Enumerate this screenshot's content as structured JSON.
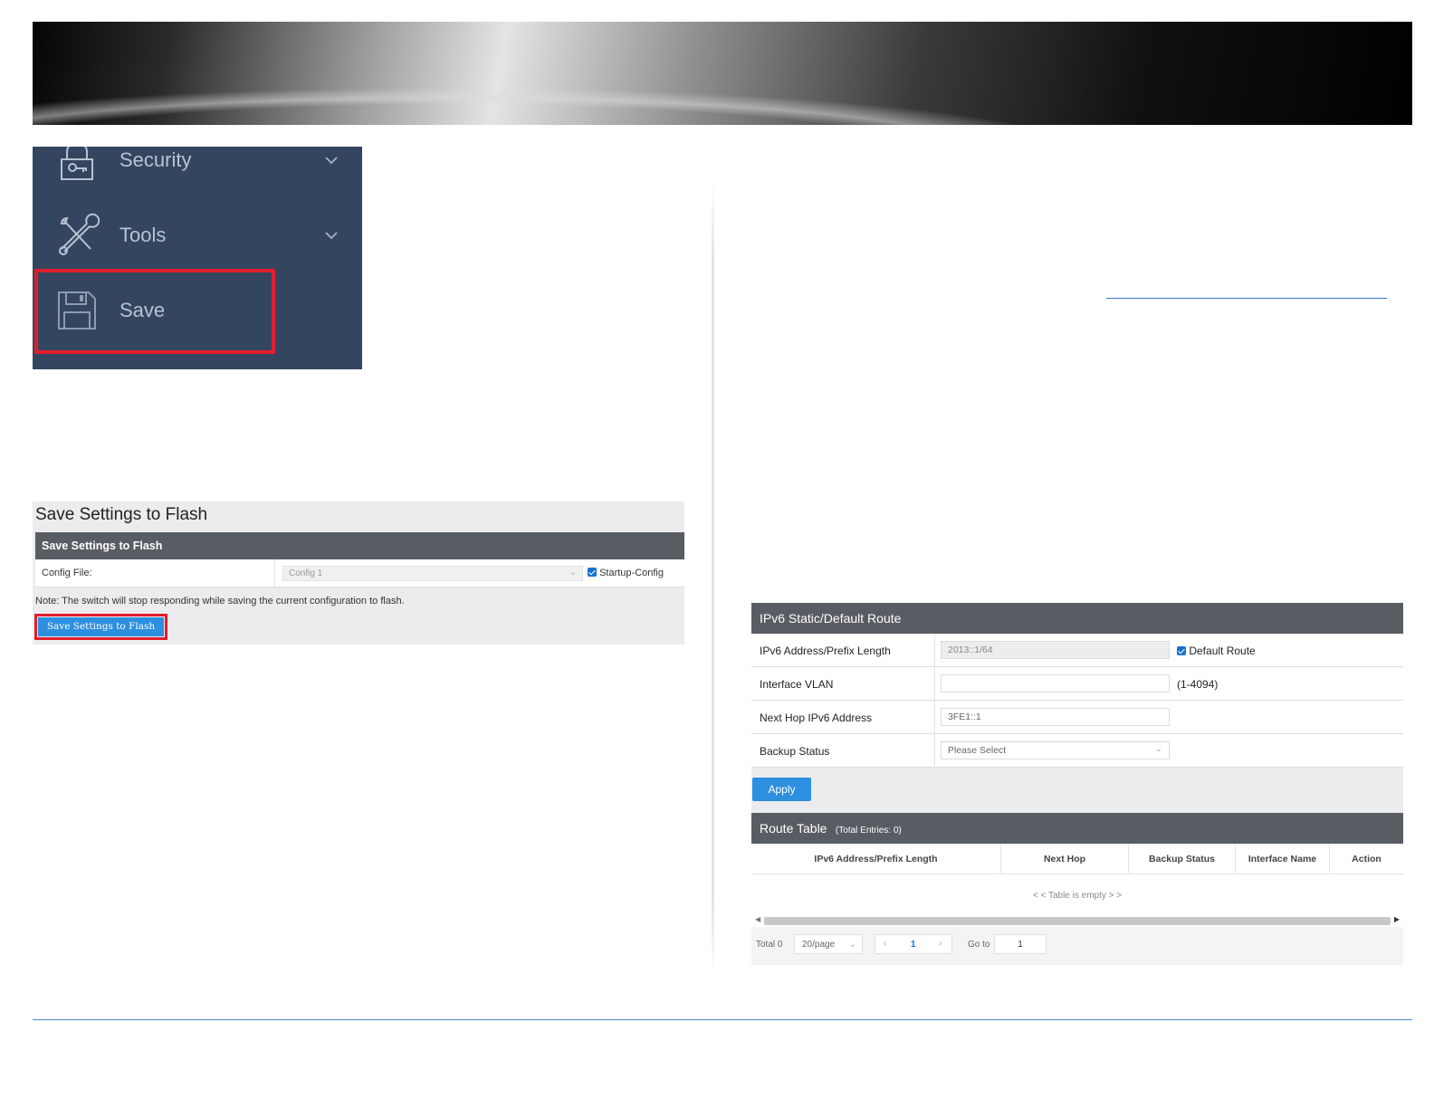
{
  "sidebar": {
    "items": [
      {
        "label": "Security",
        "icon": "lock-icon"
      },
      {
        "label": "Tools",
        "icon": "tools-icon"
      },
      {
        "label": "Save",
        "icon": "floppy-disk-icon"
      }
    ],
    "highlight_color": "#e21d2b"
  },
  "save_panel": {
    "title": "Save Settings to Flash",
    "header": "Save Settings to Flash",
    "config_file_label": "Config File:",
    "config_file_value": "Config 1",
    "startup_config_label": "Startup-Config",
    "startup_config_checked": true,
    "note": "Note: The switch will stop responding while saving the current configuration to flash.",
    "save_button": "Save Settings to Flash"
  },
  "route_panel": {
    "header": "IPv6 Static/Default Route",
    "rows": {
      "prefix_label": "IPv6 Address/Prefix Length",
      "prefix_value": "2013::1/64",
      "default_route_label": "Default Route",
      "default_route_checked": true,
      "vlan_label": "Interface VLAN",
      "vlan_value": "",
      "vlan_hint": "(1-4094)",
      "nexthop_label": "Next Hop IPv6 Address",
      "nexthop_value": "3FE1::1",
      "backup_label": "Backup Status",
      "backup_value": "Please Select"
    },
    "apply_button": "Apply",
    "table": {
      "title": "Route Table",
      "entries": "(Total Entries: 0)",
      "columns": [
        "IPv6 Address/Prefix Length",
        "Next Hop",
        "Backup Status",
        "Interface Name",
        "Action"
      ],
      "empty_text": "< < Table is empty > >"
    },
    "pager": {
      "total": "Total 0",
      "per_page": "20/page",
      "current_page": "1",
      "goto_label": "Go to",
      "goto_value": "1"
    }
  },
  "colors": {
    "sidebar_bg": "#34455f",
    "header_bar": "#585c63",
    "button_blue": "#2c8fe0",
    "highlight_red": "#e21d2b",
    "footer_line": "#4a86c8"
  }
}
